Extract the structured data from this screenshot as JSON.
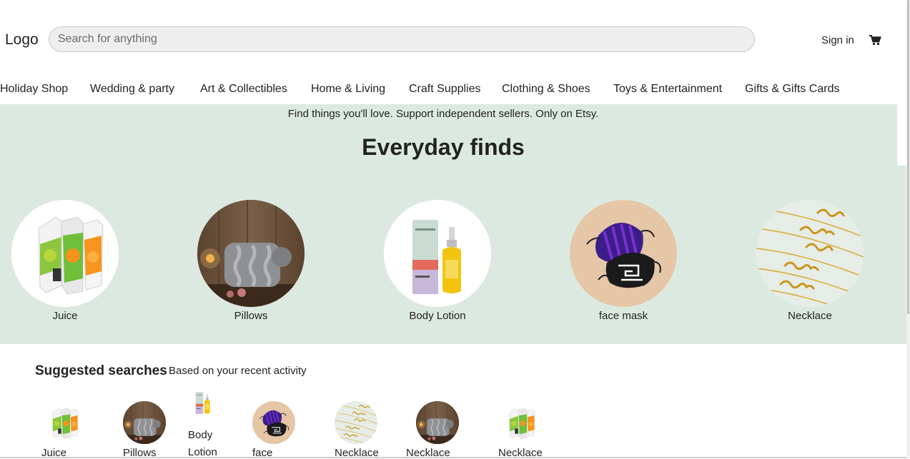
{
  "header": {
    "logo": "Logo",
    "search_placeholder": "Search for anything",
    "sign_in": "Sign in",
    "cart_icon": "shopping-cart-icon"
  },
  "categories": [
    "Holiday Shop",
    "Wedding & party",
    "Art & Collectibles",
    "Home & Living",
    "Craft Supplies",
    "Clothing & Shoes",
    "Toys & Entertainment",
    "Gifts & Gifts Cards"
  ],
  "hero": {
    "tagline": "Find things you'll love. Support independent sellers. Only on Etsy.",
    "title": "Everyday finds",
    "background": "#dce9e0",
    "items": [
      "Juice",
      "Pillows",
      "Body Lotion",
      "face mask",
      "Necklace"
    ]
  },
  "suggested": {
    "title": "Suggested searches",
    "subtitle": "Based on your recent activity",
    "items": [
      {
        "label": "Juice",
        "icon": "juice-image"
      },
      {
        "label": "Pillows",
        "icon": "pillows-image"
      },
      {
        "label": "Body",
        "label2": "Lotion",
        "icon": "body-lotion-image"
      },
      {
        "label": "face",
        "icon": "face-mask-image"
      },
      {
        "label": "Necklace",
        "icon": "necklace-image"
      },
      {
        "label": "Necklace",
        "icon": "pillows-image"
      },
      {
        "label": "Necklace",
        "icon": "juice-image"
      }
    ]
  }
}
